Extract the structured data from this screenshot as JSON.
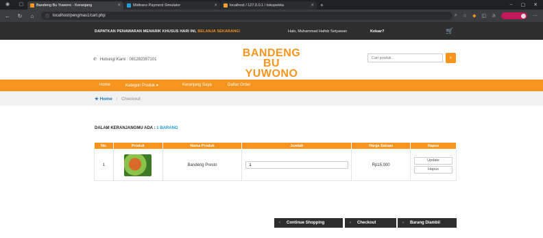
{
  "browser": {
    "tabs": [
      {
        "title": "Bandeng Bu Yuwono - Keranjang",
        "active": true,
        "color": "#f7941d"
      },
      {
        "title": "Midtrans Payment Simulator",
        "active": false,
        "color": "#1f9bd7"
      },
      {
        "title": "localhost / 127.0.0.1 / tokopekita",
        "active": false,
        "color": "#f0a030"
      }
    ],
    "url": "localhost/pengmas1/cart.php"
  },
  "topbar": {
    "promo": "DAPATKAN PENAWARAN MENARIK KHUSUS HARI INI,",
    "promo_highlight": "BELANJA SEKARANG!",
    "greeting": "Halo, Muhammad Hafidz Setyawan",
    "logout": "Keluar?"
  },
  "header": {
    "phone": "Hubungi Kami : 081282357101",
    "brand_line1": "BANDENG BU",
    "brand_line2": "YUWONO",
    "search_placeholder": "Cari produk..."
  },
  "menu": {
    "home": "Home",
    "kategori": "Kategori Produk",
    "keranjang": "Keranjang Saya",
    "order": "Daftar Order"
  },
  "breadcrumb": {
    "home": "Home",
    "current": "Checkout"
  },
  "cart": {
    "summary_label": "DALAM KERANJANGMU ADA :",
    "summary_count": "1 BARANG",
    "headers": [
      "No.",
      "Produk",
      "Nama Produk",
      "Jumlah",
      "Harga Satuan",
      "Hapus"
    ],
    "rows": [
      {
        "no": "1",
        "name": "Bandeng Presto",
        "qty": "1",
        "price": "Rp15,000"
      }
    ],
    "update_label": "Update",
    "delete_label": "Hapus"
  },
  "buttons": {
    "continue": "Continue Shopping",
    "checkout": "Checkout",
    "taken": "Barang Diambil"
  },
  "colors": {
    "accent": "#f7941d",
    "dark": "#2e2e2e",
    "link": "#1f77b4"
  }
}
